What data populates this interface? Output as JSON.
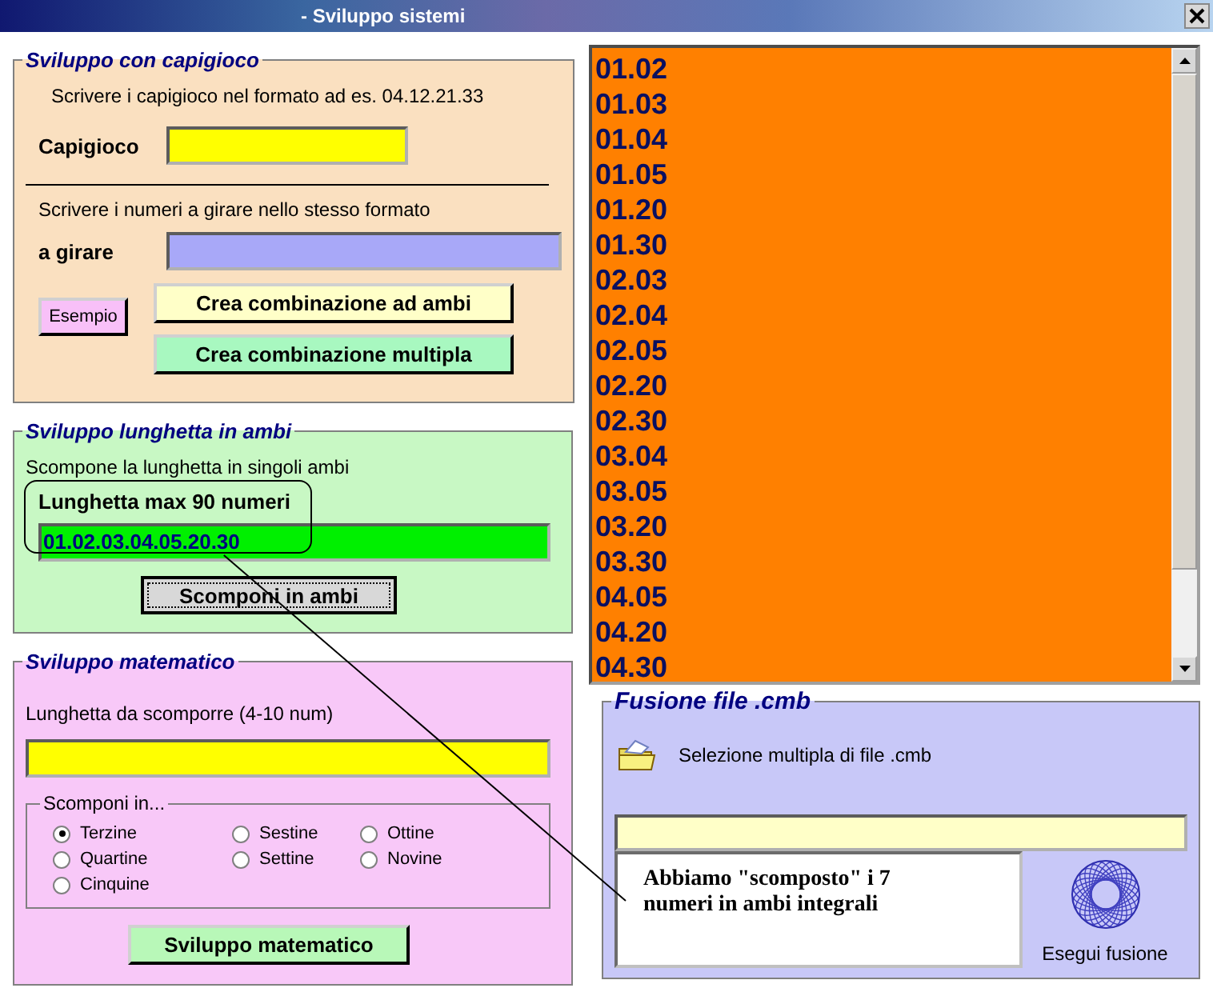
{
  "window": {
    "title": "- Sviluppo sistemi"
  },
  "capigioco_frame": {
    "title": "Sviluppo con capigioco",
    "hint": "Scrivere i capigioco nel formato ad es. 04.12.21.33",
    "capigioco_label": "Capigioco",
    "hint_2": "Scrivere i numeri a girare nello stesso formato",
    "girare_label": "a girare",
    "buttons": [
      {
        "label": "Esempio",
        "kind": "small"
      },
      {
        "label": "Crea combinazione ad ambi",
        "kind": "wide"
      },
      {
        "label": "Crea combinazione multipla",
        "kind": "wide"
      }
    ]
  },
  "lunghetta_frame": {
    "title": "Sviluppo lunghetta in ambi",
    "description": "Scompone la lunghetta in singoli ambi",
    "field_label": "Lunghetta max 90 numeri",
    "value": "01.02.03.04.05.20.30",
    "button": "Scomponi in ambi"
  },
  "matematico_frame": {
    "title": "Sviluppo matematico",
    "field_label": "Lunghetta da scomporre (4-10 num)",
    "group_title": "Scomponi in...",
    "option_columns": [
      [
        {
          "label": "Terzine",
          "selected": true
        },
        {
          "label": "Quartine",
          "selected": false
        },
        {
          "label": "Cinquine",
          "selected": false
        }
      ],
      [
        {
          "label": "Sestine",
          "selected": false
        },
        {
          "label": "Settine",
          "selected": false
        }
      ],
      [
        {
          "label": "Ottine",
          "selected": false
        },
        {
          "label": "Novine",
          "selected": false
        }
      ]
    ],
    "button": "Sviluppo matematico"
  },
  "result_list": [
    "01.02",
    "01.03",
    "01.04",
    "01.05",
    "01.20",
    "01.30",
    "02.03",
    "02.04",
    "02.05",
    "02.20",
    "02.30",
    "03.04",
    "03.05",
    "03.20",
    "03.30",
    "04.05",
    "04.20",
    "04.30"
  ],
  "fusion_frame": {
    "title": "Fusione file .cmb",
    "select_label": "Selezione multipla di file .cmb",
    "run_label": "Esegui fusione"
  },
  "note": "Abbiamo \"scomposto\" i 7 numeri in ambi integrali"
}
